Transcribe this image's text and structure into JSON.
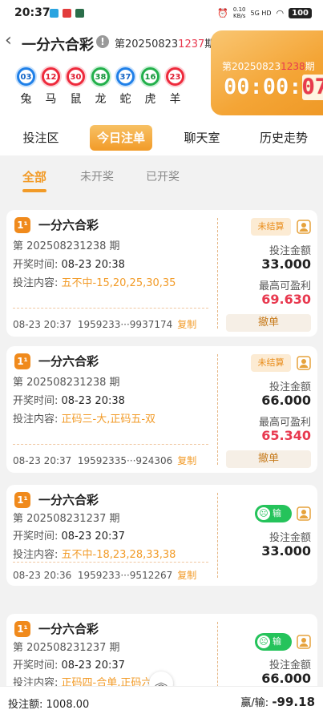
{
  "status_bar": {
    "time": "20:37",
    "speed_value": "0.10",
    "speed_unit": "KB/s",
    "network": "5G HD",
    "battery": "100"
  },
  "header": {
    "title": "一分六合彩",
    "info_icon": "info-icon",
    "issue_prefix": "第20250823",
    "issue_highlight": "1237",
    "issue_suffix": "期",
    "balls": [
      {
        "number": "03",
        "zodiac": "兔",
        "color": "blue"
      },
      {
        "number": "12",
        "zodiac": "马",
        "color": "red"
      },
      {
        "number": "30",
        "zodiac": "鼠",
        "color": "red"
      },
      {
        "number": "38",
        "zodiac": "龙",
        "color": "green"
      },
      {
        "number": "37",
        "zodiac": "蛇",
        "color": "blue"
      },
      {
        "number": "16",
        "zodiac": "虎",
        "color": "green"
      },
      {
        "number": "23",
        "zodiac": "羊",
        "color": "red"
      }
    ]
  },
  "countdown": {
    "issue_prefix": "第20250823",
    "issue_highlight": "1238",
    "issue_suffix": "期",
    "time_main": "00:00:",
    "time_highlight": "07"
  },
  "tabs": [
    {
      "label": "投注区",
      "active": false
    },
    {
      "label": "今日注单",
      "active": true
    },
    {
      "label": "聊天室",
      "active": false
    },
    {
      "label": "历史走势",
      "active": false
    }
  ],
  "subtabs": [
    {
      "label": "全部",
      "active": true
    },
    {
      "label": "未开奖",
      "active": false
    },
    {
      "label": "已开奖",
      "active": false
    }
  ],
  "labels": {
    "open_time": "开奖时间: ",
    "bet_content": "投注内容: ",
    "bet_amount": "投注金额",
    "max_win": "最高可盈利",
    "copy": "复制",
    "cancel": "撤单",
    "pending": "未结算",
    "lost": "输"
  },
  "orders": [
    {
      "game": "一分六合彩",
      "issue": "第 202508231238 期",
      "open_time": "08-23 20:38",
      "content": "五不中-15,20,25,30,35",
      "time": "08-23 20:37",
      "order_no": "1959233···9937174",
      "status": "pending",
      "amount": "33.000",
      "max_win": "69.630"
    },
    {
      "game": "一分六合彩",
      "issue": "第 202508231238 期",
      "open_time": "08-23 20:38",
      "content": "正码三-大,正码五-双",
      "time": "08-23 20:37",
      "order_no": "19592335···924306",
      "status": "pending",
      "amount": "66.000",
      "max_win": "65.340"
    },
    {
      "game": "一分六合彩",
      "issue": "第 202508231237 期",
      "open_time": "08-23 20:37",
      "content": "五不中-18,23,28,33,38",
      "time": "08-23 20:36",
      "order_no": "1959233···9512267",
      "status": "lost",
      "amount": "33.000"
    },
    {
      "game": "一分六合彩",
      "issue": "第 202508231237 期",
      "open_time": "08-23 20:37",
      "content": "正码四-合单,正码六-双",
      "status": "lost",
      "amount": "66.000"
    }
  ],
  "footer": {
    "total_label": "投注额: ",
    "total_value": "1008.00",
    "win_label": "赢/输: ",
    "win_value": "-99.18"
  },
  "colors": {
    "accent": "#f29b28",
    "red": "#e8394f",
    "green": "#25c35b"
  }
}
